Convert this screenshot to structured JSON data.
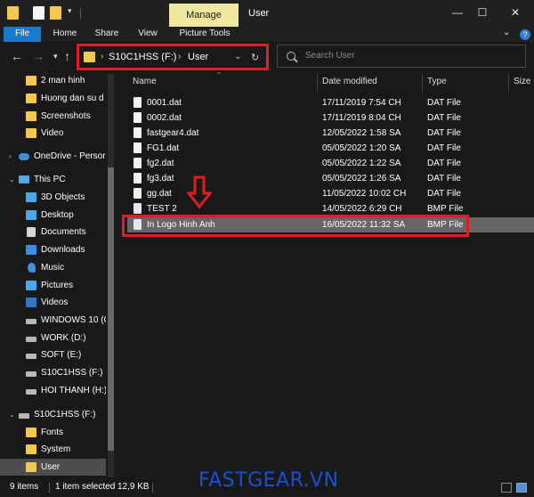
{
  "window": {
    "title": "User",
    "manage_tab": "Manage",
    "minimize_icon": "minimize-icon",
    "maximize_icon": "maximize-icon",
    "close_icon": "close-icon"
  },
  "ribbon": {
    "tabs": [
      "File",
      "Home",
      "Share",
      "View",
      "Picture Tools"
    ],
    "help_icon": "help-icon"
  },
  "address": {
    "segments": [
      "S10C1HSS (F:)",
      "User"
    ],
    "refresh_icon": "refresh-icon"
  },
  "search": {
    "placeholder": "Search User"
  },
  "nav": {
    "items": [
      {
        "label": "2 man hinh",
        "icon": "folder-icon"
      },
      {
        "label": "Huong dan su d",
        "icon": "folder-icon"
      },
      {
        "label": "Screenshots",
        "icon": "folder-icon"
      },
      {
        "label": "Video",
        "icon": "folder-icon"
      },
      {
        "label": "OneDrive - Persor",
        "icon": "cloud-icon"
      },
      {
        "label": "This PC",
        "icon": "computer-icon"
      },
      {
        "label": "3D Objects",
        "icon": "cube-icon"
      },
      {
        "label": "Desktop",
        "icon": "desktop-icon"
      },
      {
        "label": "Documents",
        "icon": "document-icon"
      },
      {
        "label": "Downloads",
        "icon": "download-icon"
      },
      {
        "label": "Music",
        "icon": "music-icon"
      },
      {
        "label": "Pictures",
        "icon": "picture-icon"
      },
      {
        "label": "Videos",
        "icon": "video-icon"
      },
      {
        "label": "WINDOWS 10 (C",
        "icon": "drive-icon"
      },
      {
        "label": "WORK (D:)",
        "icon": "drive-icon"
      },
      {
        "label": "SOFT (E:)",
        "icon": "drive-icon"
      },
      {
        "label": "S10C1HSS (F:)",
        "icon": "drive-icon"
      },
      {
        "label": "HOI THANH (H:)",
        "icon": "drive-icon"
      },
      {
        "label": "S10C1HSS (F:)",
        "icon": "drive-icon"
      },
      {
        "label": "Fonts",
        "icon": "folder-icon"
      },
      {
        "label": "System",
        "icon": "folder-icon"
      },
      {
        "label": "User",
        "icon": "folder-icon",
        "selected": true
      }
    ]
  },
  "columns": {
    "name": "Name",
    "date": "Date modified",
    "type": "Type",
    "size": "Size"
  },
  "files": [
    {
      "name": "0001.dat",
      "date": "17/11/2019 7:54 CH",
      "type": "DAT File"
    },
    {
      "name": "0002.dat",
      "date": "17/11/2019 8:04 CH",
      "type": "DAT File"
    },
    {
      "name": "fastgear4.dat",
      "date": "12/05/2022 1:58 SA",
      "type": "DAT File"
    },
    {
      "name": "FG1.dat",
      "date": "05/05/2022 1:20 SA",
      "type": "DAT File"
    },
    {
      "name": "fg2.dat",
      "date": "05/05/2022 1:22 SA",
      "type": "DAT File"
    },
    {
      "name": "fg3.dat",
      "date": "05/05/2022 1:26 SA",
      "type": "DAT File"
    },
    {
      "name": "gg.dat",
      "date": "11/05/2022 10:02 CH",
      "type": "DAT File"
    },
    {
      "name": "TEST 2",
      "date": "14/05/2022 6:29 CH",
      "type": "BMP File"
    },
    {
      "name": "In Logo Hinh Anh",
      "date": "16/05/2022 11:32 SA",
      "type": "BMP File",
      "selected": true
    }
  ],
  "status": {
    "items_count": "9 items",
    "selection": "1 item selected",
    "size": "12,9 KB"
  },
  "watermark": "FASTGEAR.VN",
  "colors": {
    "background": "#191919",
    "accent_blue": "#1979ca",
    "highlight_red": "#e01d24",
    "folder_yellow": "#f3c94d",
    "manage_tab": "#f0e8a0",
    "watermark_blue": "#1a4fd6"
  }
}
